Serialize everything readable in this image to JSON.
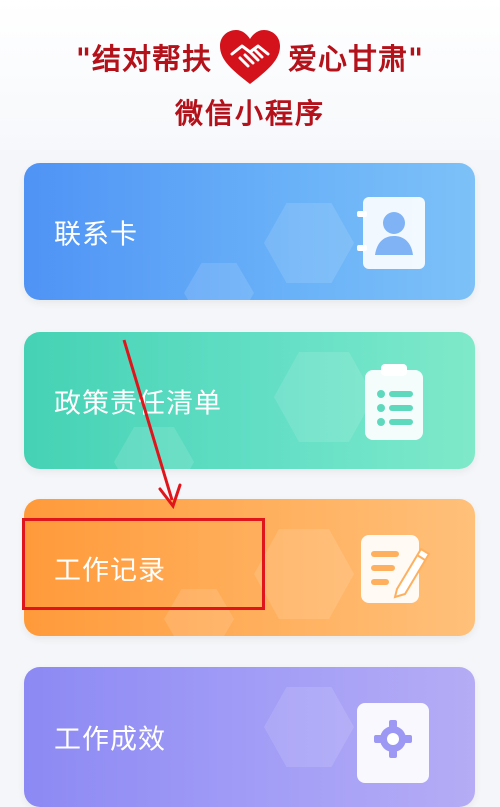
{
  "header": {
    "title_left": "\"结对帮扶",
    "title_right": "爱心甘肃\"",
    "subtitle": "微信小程序",
    "logo_icon": "heart-handshake-icon"
  },
  "menu": {
    "items": [
      {
        "label": "联系卡",
        "icon": "contact-card-icon"
      },
      {
        "label": "政策责任清单",
        "icon": "clipboard-list-icon"
      },
      {
        "label": "工作记录",
        "icon": "note-pencil-icon"
      },
      {
        "label": "工作成效",
        "icon": "gear-icon"
      }
    ]
  },
  "annotation": {
    "highlighted_item": "工作记录",
    "color": "#e0151b"
  },
  "colors": {
    "brand_red": "#b4121b",
    "card_blue": "#4f93f5",
    "card_teal": "#45d2b4",
    "card_orange": "#ff9a3a",
    "card_purple": "#8c89f4"
  }
}
